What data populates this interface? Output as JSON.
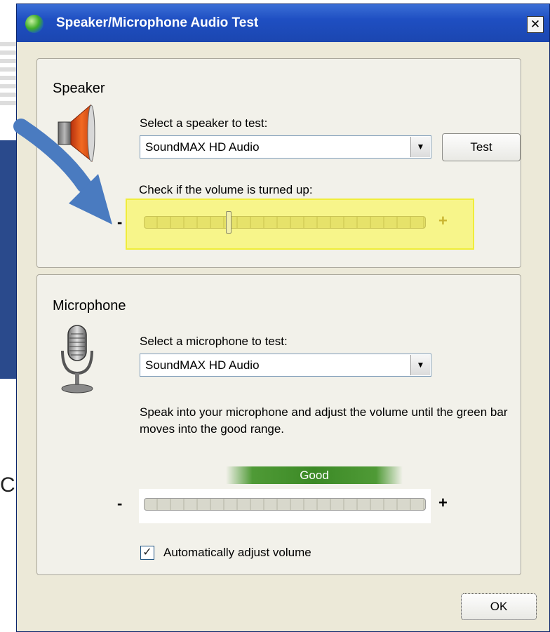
{
  "window": {
    "title": "Speaker/Microphone Audio Test",
    "close_label": "✕"
  },
  "speaker": {
    "group_title": "Speaker",
    "select_label": "Select a speaker to test:",
    "device": "SoundMAX HD Audio",
    "test_button": "Test",
    "volume_label": "Check if the volume is turned up:",
    "volume_level": 0.3,
    "minus": "-",
    "plus": "+"
  },
  "microphone": {
    "group_title": "Microphone",
    "select_label": "Select a microphone to test:",
    "device": "SoundMAX HD Audio",
    "instructions": "Speak into your microphone and adjust the volume until the green bar moves into the good range.",
    "range_label": "Good",
    "minus": "-",
    "plus": "+",
    "auto_adjust_label": "Automatically adjust volume",
    "auto_adjust_checked": true
  },
  "footer": {
    "ok_button": "OK"
  },
  "colors": {
    "titlebar": "#1f4fc2",
    "highlight": "#f7f58a",
    "good": "#3c8a26",
    "arrow": "#4a7bc0"
  }
}
